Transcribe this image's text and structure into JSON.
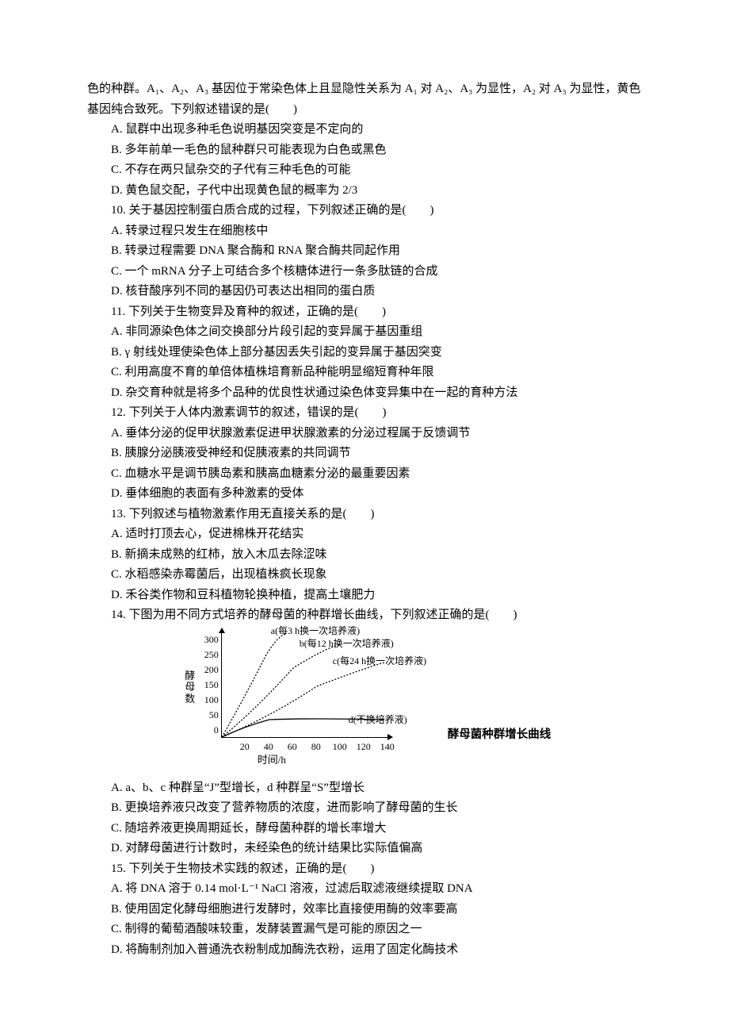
{
  "intro": "色的种群。A₁、A₂、A₃ 基因位于常染色体上且显隐性关系为 A₁ 对 A₂、A₃ 为显性，A₂ 对 A₃ 为显性，黄色基因纯合致死。下列叙述错误的是(　　)",
  "q9": {
    "A": "A. 鼠群中出现多种毛色说明基因突变是不定向的",
    "B": "B. 多年前单一毛色的鼠种群只可能表现为白色或黑色",
    "C": "C. 不存在两只鼠杂交的子代有三种毛色的可能",
    "D": "D. 黄色鼠交配，子代中出现黄色鼠的概率为 2/3"
  },
  "q10": {
    "stem": "10. 关于基因控制蛋白质合成的过程，下列叙述正确的是(　　)",
    "A": "A. 转录过程只发生在细胞核中",
    "B": "B. 转录过程需要 DNA 聚合酶和 RNA 聚合酶共同起作用",
    "C": "C. 一个 mRNA 分子上可结合多个核糖体进行一条多肽链的合成",
    "D": "D. 核苷酸序列不同的基因仍可表达出相同的蛋白质"
  },
  "q11": {
    "stem": "11. 下列关于生物变异及育种的叙述，正确的是(　　)",
    "A": "A. 非同源染色体之间交换部分片段引起的变异属于基因重组",
    "B": "B. γ 射线处理使染色体上部分基因丢失引起的变异属于基因突变",
    "C": "C. 利用高度不育的单倍体植株培育新品种能明显缩短育种年限",
    "D": "D. 杂交育种就是将多个品种的优良性状通过染色体变异集中在一起的育种方法"
  },
  "q12": {
    "stem": "12. 下列关于人体内激素调节的叙述，错误的是(　　)",
    "A": "A. 垂体分泌的促甲状腺激素促进甲状腺激素的分泌过程属于反馈调节",
    "B": "B. 胰腺分泌胰液受神经和促胰液素的共同调节",
    "C": "C. 血糖水平是调节胰岛素和胰高血糖素分泌的最重要因素",
    "D": "D. 垂体细胞的表面有多种激素的受体"
  },
  "q13": {
    "stem": "13. 下列叙述与植物激素作用无直接关系的是(　　)",
    "A": "A. 适时打顶去心，促进棉株开花结实",
    "B": "B. 新摘未成熟的红柿，放入木瓜去除涩味",
    "C": "C. 水稻感染赤霉菌后，出现植株疯长现象",
    "D": "D. 禾谷类作物和豆科植物轮换种植，提高土壤肥力"
  },
  "q14": {
    "stem": "14. 下图为用不同方式培养的酵母菌的种群增长曲线，下列叙述正确的是(　　)",
    "A": "A. a、b、c 种群呈“J”型增长，d 种群呈“S”型增长",
    "B": "B. 更换培养液只改变了营养物质的浓度，进而影响了酵母菌的生长",
    "C": "C. 随培养液更换周期延长，酵母菌种群的增长率增大",
    "D": "D. 对酵母菌进行计数时，未经染色的统计结果比实际值偏高"
  },
  "q15": {
    "stem": "15. 下列关于生物技术实践的叙述，正确的是(　　)",
    "A": "A. 将 DNA 溶于 0.14 mol·L⁻¹ NaCl 溶液，过滤后取滤液继续提取 DNA",
    "B": "B. 使用固定化酵母细胞进行发酵时，效率比直接使用酶的效率要高",
    "C": "C. 制得的葡萄酒酸味较重，发酵装置漏气是可能的原因之一",
    "D": "D. 将酶制剂加入普通洗衣粉制成加酶洗衣粉，运用了固定化酶技术"
  },
  "figure": {
    "ylabel_lines": [
      "酵",
      "母",
      "数"
    ],
    "yticks": [
      "300",
      "250",
      "200",
      "150",
      "100",
      "50",
      "0"
    ],
    "xticks": [
      {
        "v": "20",
        "p": 30
      },
      {
        "v": "40",
        "p": 60
      },
      {
        "v": "60",
        "p": 90
      },
      {
        "v": "80",
        "p": 120
      },
      {
        "v": "100",
        "p": 150
      },
      {
        "v": "120",
        "p": 180
      },
      {
        "v": "140",
        "p": 210
      }
    ],
    "xlabel": "时间/h",
    "series_labels": {
      "a": "a(每3 h换一次培养液)",
      "b": "b(每12 h换一次培养液)",
      "c": "c(每24 h换一次培养液)",
      "d": "d(不换培养液)"
    },
    "caption": "酵母菌种群增长曲线"
  },
  "chart_data": {
    "type": "line",
    "title": "酵母菌种群增长曲线",
    "xlabel": "时间/h",
    "ylabel": "酵母数",
    "xlim": [
      0,
      140
    ],
    "ylim": [
      0,
      300
    ],
    "x": [
      0,
      20,
      40,
      60,
      80,
      100,
      120,
      140
    ],
    "series": [
      {
        "name": "a(每3 h换一次培养液)",
        "values": [
          0,
          130,
          250,
          300,
          null,
          null,
          null,
          null
        ]
      },
      {
        "name": "b(每12 h换一次培养液)",
        "values": [
          0,
          70,
          140,
          190,
          230,
          260,
          null,
          null
        ]
      },
      {
        "name": "c(每24 h换一次培养液)",
        "values": [
          0,
          45,
          85,
          120,
          150,
          175,
          195,
          210
        ]
      },
      {
        "name": "d(不换培养液)",
        "values": [
          0,
          30,
          50,
          55,
          55,
          52,
          50,
          50
        ]
      }
    ]
  }
}
